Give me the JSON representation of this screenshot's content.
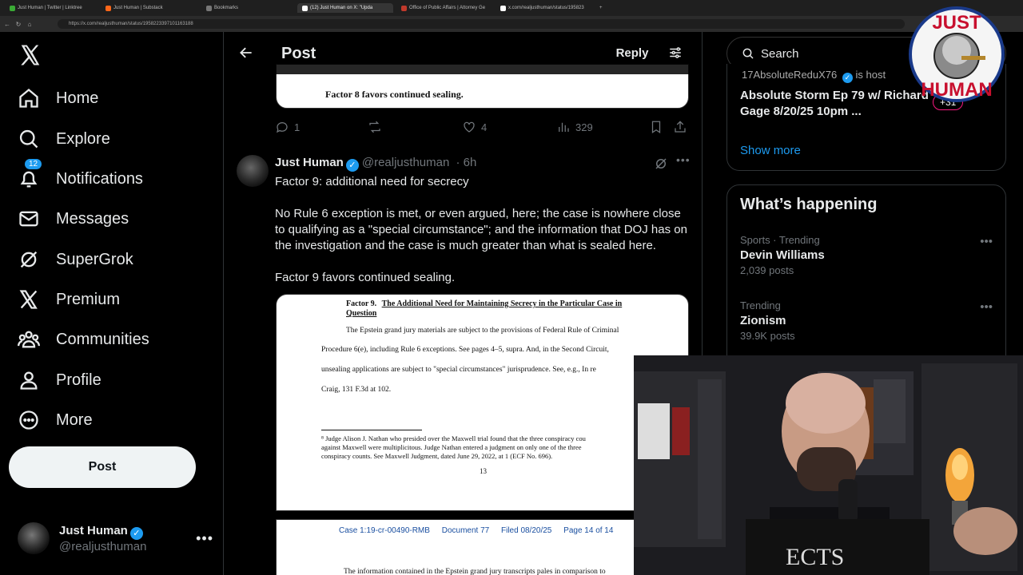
{
  "browser": {
    "tabs": [
      {
        "label": "Just Human | Twitter | Linktree",
        "color": "#3aaa35"
      },
      {
        "label": "Just Human | Substack",
        "color": "#ff6719"
      },
      {
        "label": "Bookmarks",
        "color": "#777777"
      },
      {
        "label": "(12) Just Human on X: \"Upda",
        "color": "#ffffff"
      },
      {
        "label": "Office of Public Affairs | Attorney Ge",
        "color": "#c0392b"
      },
      {
        "label": "x.com/realjusthuman/status/195823",
        "color": "#ffffff"
      }
    ],
    "url": "https://x.com/realjusthuman/status/1958223397101163188"
  },
  "nav": {
    "items": [
      {
        "label": "Home"
      },
      {
        "label": "Explore"
      },
      {
        "label": "Notifications",
        "badge": "12"
      },
      {
        "label": "Messages"
      },
      {
        "label": "SuperGrok"
      },
      {
        "label": "Premium"
      },
      {
        "label": "Communities"
      },
      {
        "label": "Profile"
      },
      {
        "label": "More"
      }
    ],
    "post_label": "Post",
    "account": {
      "name": "Just Human",
      "handle": "@realjusthuman"
    }
  },
  "header": {
    "title": "Post",
    "reply_label": "Reply"
  },
  "doc1": {
    "text": "Factor 8 favors continued sealing."
  },
  "tweet1_actions": {
    "replies": "1",
    "likes": "4",
    "views": "329"
  },
  "tweet2": {
    "name": "Just Human",
    "handle": "@realjusthuman",
    "time": "· 6h",
    "p1": "Factor 9: additional need for secrecy",
    "p2": "No Rule 6 exception is met, or even argued, here; the case is nowhere close to qualifying as a \"special circumstance\"; and the information that DOJ has on the investigation and the case is much greater than what is sealed here.",
    "p3": "Factor 9 favors continued sealing."
  },
  "doc2": {
    "heading_prefix": "Factor 9.",
    "heading": "The Additional Need for Maintaining Secrecy in the Particular Case in Question",
    "body1": "The Epstein grand jury materials are subject to the provisions of Federal Rule of Criminal",
    "body2": "Procedure 6(e), including Rule 6 exceptions.  See pages 4–5, supra. And, in the Second Circuit,",
    "body3": "unsealing applications are subject to \"special circumstances\" jurisprudence.  See, e.g., In re",
    "body4": "Craig, 131 F.3d at 102.",
    "footnote1": "⁸ Judge Alison J. Nathan who presided over the Maxwell trial found that the three conspiracy cou",
    "footnote2": "against Maxwell were multiplicitous.  Judge Nathan entered a judgment on only one of the three",
    "footnote3": "conspiracy counts.  See Maxwell Judgment, dated June 29, 2022, at 1 (ECF No. 696).",
    "page_num": "13"
  },
  "doc3": {
    "case": "Case 1:19-cr-00490-RMB",
    "document": "Document 77",
    "filed": "Filed 08/20/25",
    "page": "Page 14 of 14",
    "text": "The information contained in the Epstein grand jury transcripts pales in comparison to"
  },
  "right": {
    "search_placeholder": "Search",
    "card1_user": "17AbsoluteReduX76",
    "card1_host": "is host",
    "card1_title": "Absolute Storm Ep 79 w/ Richard Gage 8/20/25 10pm ...",
    "card1_count": "+31",
    "show_more": "Show more",
    "whats_happening": "What’s happening",
    "trends": [
      {
        "context": "Sports · Trending",
        "name": "Devin Williams",
        "posts": "2,039 posts"
      },
      {
        "context": "Trending",
        "name": "Zionism",
        "posts": "39.9K posts"
      }
    ]
  },
  "overlay": {
    "logo_top": "JUST",
    "logo_bottom": "HUMAN",
    "shirt_text": "ECTS"
  }
}
